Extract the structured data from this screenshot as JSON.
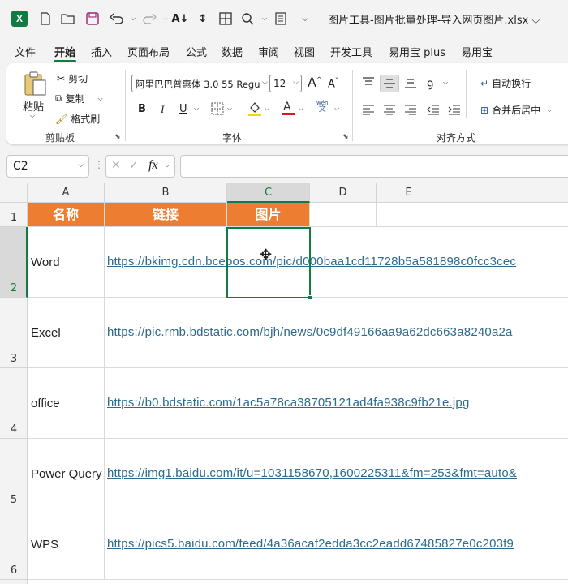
{
  "titlebar": {
    "app_logo": "X",
    "title": "图片工具-图片批量处理-导入网页图片.xlsx ⌵",
    "icons": [
      "new-file-icon",
      "open-folder-icon",
      "save-icon",
      "undo-icon",
      "redo-icon",
      "sort-asc-icon",
      "sort-icon",
      "borders-icon",
      "search-icon",
      "form-icon",
      "customize-icon"
    ]
  },
  "menu": {
    "tabs": [
      "文件",
      "开始",
      "插入",
      "页面布局",
      "公式",
      "数据",
      "审阅",
      "视图",
      "开发工具",
      "易用宝 plus",
      "易用宝"
    ],
    "active_tab": "开始"
  },
  "ribbon": {
    "clipboard": {
      "paste": "粘贴",
      "cut": "剪切",
      "copy": "复制",
      "format_painter": "格式刷",
      "group_label": "剪贴板"
    },
    "font": {
      "font_name": "阿里巴巴普惠体 3.0 55 Regu",
      "font_size": "12",
      "bold": "B",
      "italic": "I",
      "underline": "U",
      "group_label": "字体",
      "increase": "A",
      "decrease": "A",
      "phonetic_top": "wén",
      "phonetic_bottom": "文"
    },
    "alignment": {
      "wrap_text": "自动换行",
      "merge_center": "合并后居中",
      "group_label": "对齐方式"
    },
    "accent_color": "#107c41",
    "font_color_bar": "#e81123",
    "fill_color_bar": "#ffd400"
  },
  "formula_bar": {
    "name_box": "C2",
    "fx": "fx",
    "formula": ""
  },
  "grid": {
    "columns": [
      "A",
      "B",
      "C",
      "D",
      "E"
    ],
    "selected_column": "C",
    "rows": [
      "1",
      "2",
      "3",
      "4",
      "5",
      "6"
    ],
    "selected_row": "2",
    "header": {
      "a": "名称",
      "b": "链接",
      "c": "图片"
    },
    "data": [
      {
        "name": "Word",
        "link": "https://bkimg.cdn.bcebos.com/pic/d000baa1cd11728b5a581898c0fcc3cec"
      },
      {
        "name": "Excel",
        "link": "https://pic.rmb.bdstatic.com/bjh/news/0c9df49166aa9a62dc663a8240a2a"
      },
      {
        "name": "office",
        "link": "https://b0.bdstatic.com/1ac5a78ca38705121ad4fa938c9fb21e.jpg"
      },
      {
        "name": "Power Query",
        "link": "https://img1.baidu.com/it/u=1031158670,1600225311&fm=253&fmt=auto&"
      },
      {
        "name": "WPS",
        "link": "https://pics5.baidu.com/feed/4a36acaf2edda3cc2eadd67485827e0c203f9"
      }
    ],
    "header_fill": "#ed7d31"
  }
}
